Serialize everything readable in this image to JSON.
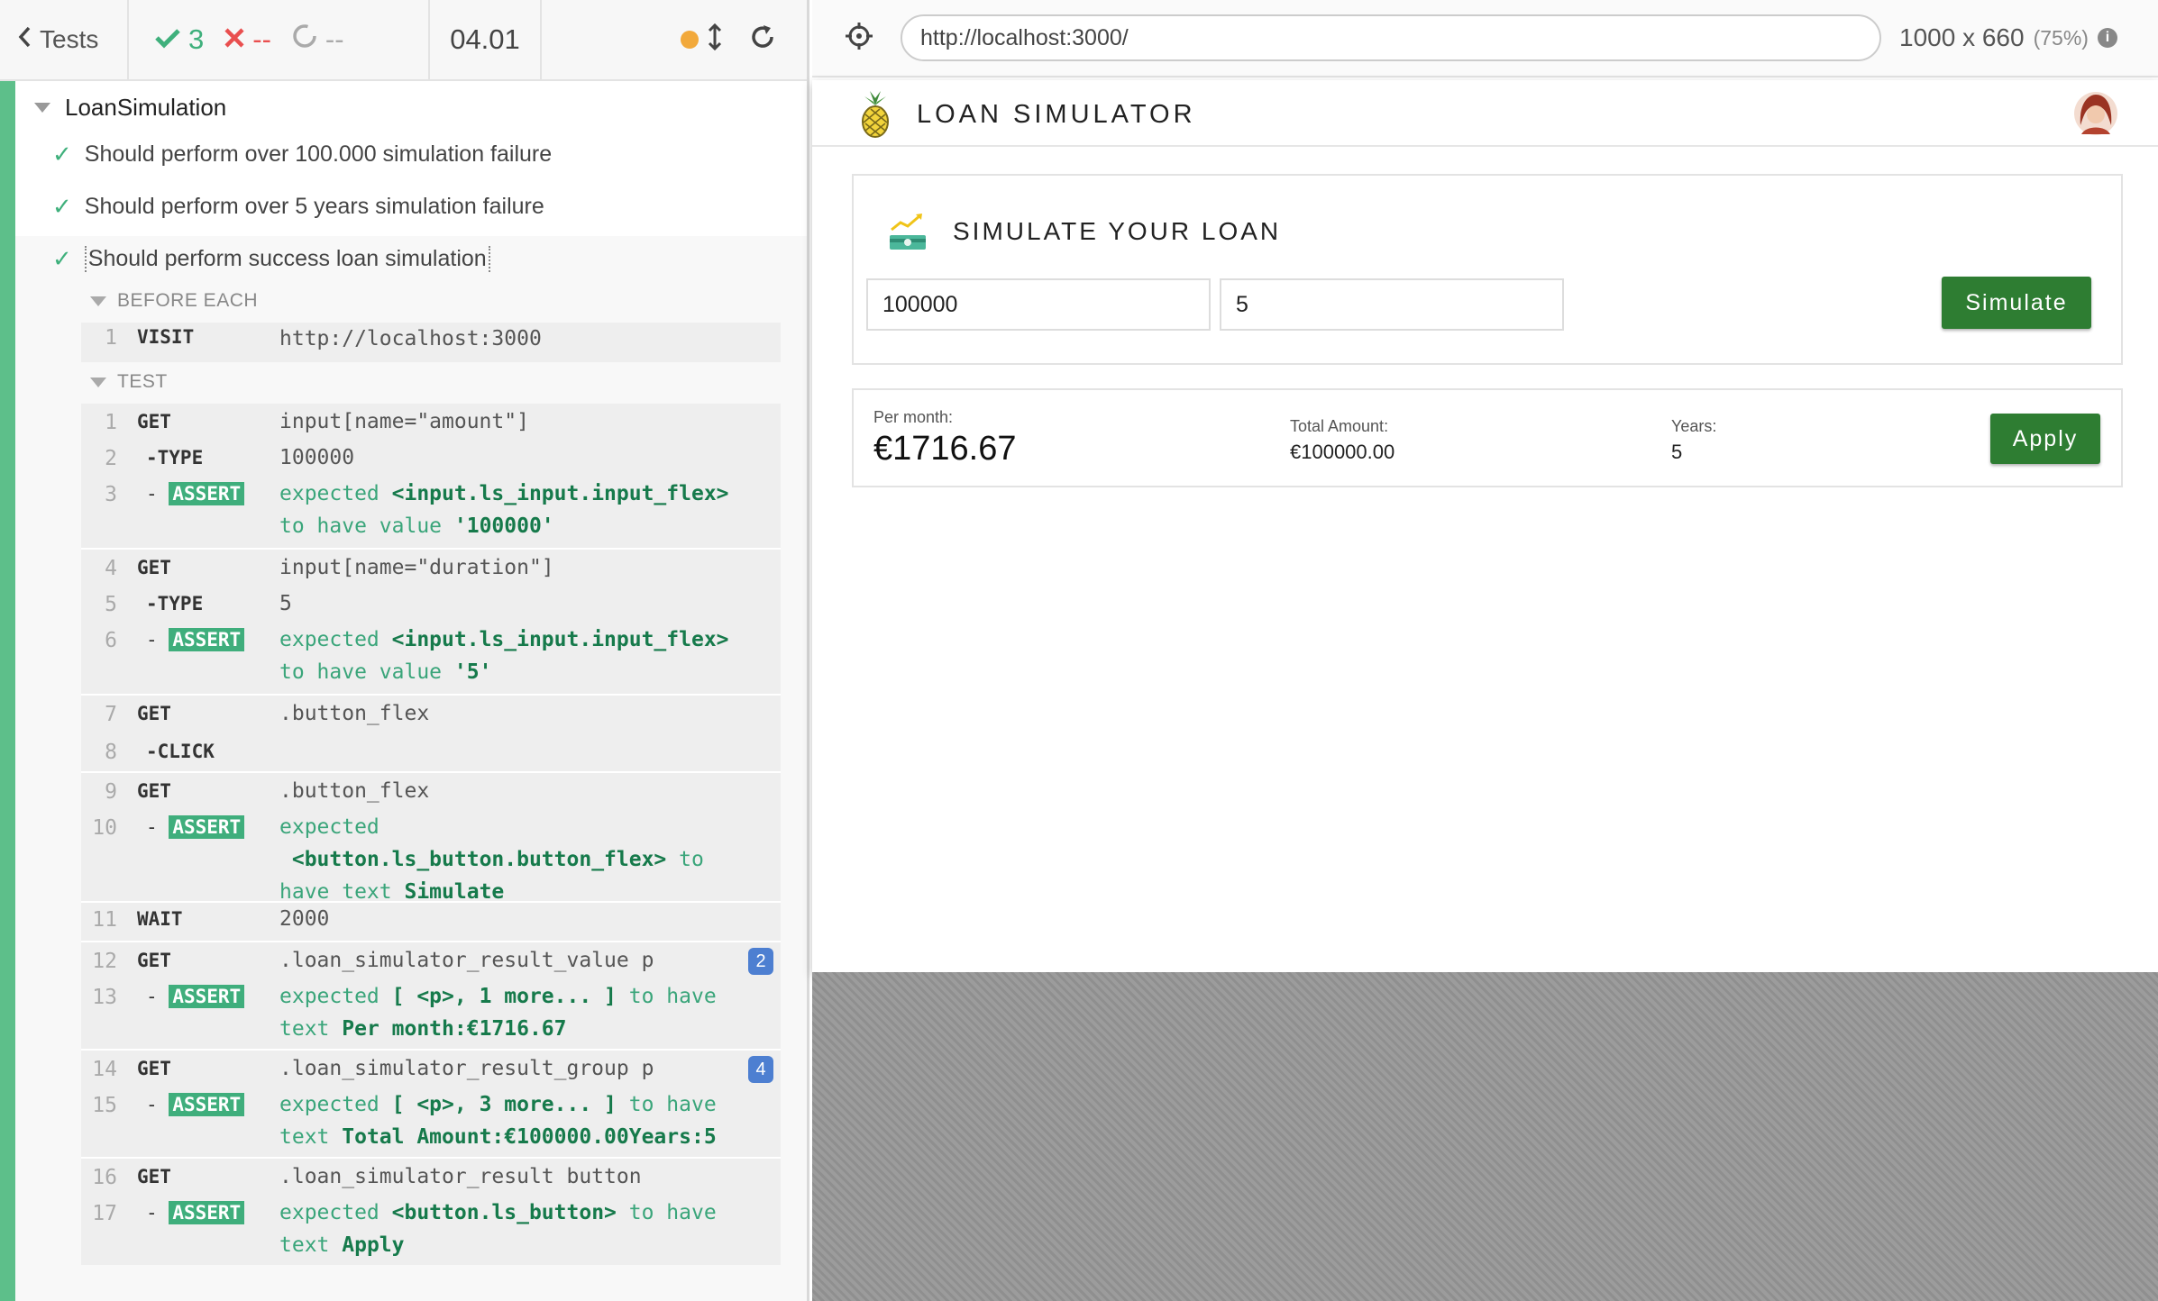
{
  "reporter": {
    "header": {
      "back_label": "Tests",
      "passed": "3",
      "failed": "--",
      "pending": "--",
      "duration": "04.01"
    },
    "suite": "LoanSimulation",
    "tests": [
      "Should perform over 100.000 simulation failure",
      "Should perform over 5 years simulation failure",
      "Should perform success loan simulation"
    ],
    "hooks": {
      "before_each": "BEFORE EACH",
      "test": "TEST"
    },
    "commands": [
      {
        "num": "1",
        "name": "VISIT",
        "msg": "http://localhost:3000"
      },
      {
        "num": "1",
        "name": "GET",
        "msg": "input[name=\"amount\"]"
      },
      {
        "num": "2",
        "name": "-TYPE",
        "msg": "100000"
      },
      {
        "num": "3",
        "name": "ASSERT",
        "pre": "expected",
        "sub": "<input.ls_input.input_flex>",
        "mid": "to have value",
        "val": "'100000'"
      },
      {
        "num": "4",
        "name": "GET",
        "msg": "input[name=\"duration\"]"
      },
      {
        "num": "5",
        "name": "-TYPE",
        "msg": "5"
      },
      {
        "num": "6",
        "name": "ASSERT",
        "pre": "expected",
        "sub": "<input.ls_input.input_flex>",
        "mid": "to have value",
        "val": "'5'"
      },
      {
        "num": "7",
        "name": "GET",
        "msg": ".button_flex"
      },
      {
        "num": "8",
        "name": "-CLICK",
        "msg": ""
      },
      {
        "num": "9",
        "name": "GET",
        "msg": ".button_flex"
      },
      {
        "num": "10",
        "name": "ASSERT",
        "pre": "expected",
        "sub": "<button.ls_button.button_flex>",
        "mid": "to have text",
        "val": "Simulate"
      },
      {
        "num": "11",
        "name": "WAIT",
        "msg": "2000"
      },
      {
        "num": "12",
        "name": "GET",
        "msg": ".loan_simulator_result_value p",
        "badge": "2"
      },
      {
        "num": "13",
        "name": "ASSERT",
        "pre": "expected",
        "sub": "[ <p>, 1 more... ]",
        "mid": "to have text",
        "val": "Per month:€1716.67"
      },
      {
        "num": "14",
        "name": "GET",
        "msg": ".loan_simulator_result_group p",
        "badge": "4"
      },
      {
        "num": "15",
        "name": "ASSERT",
        "pre": "expected",
        "sub": "[ <p>, 3 more... ]",
        "mid": "to have text",
        "val": "Total Amount:€100000.00Years:5"
      },
      {
        "num": "16",
        "name": "GET",
        "msg": ".loan_simulator_result button"
      },
      {
        "num": "17",
        "name": "ASSERT",
        "pre": "expected",
        "sub": "<button.ls_button>",
        "mid": "to have text",
        "val": "Apply"
      }
    ],
    "assert_tag": "ASSERT",
    "assert_prefix": "-",
    "to_word": "to",
    "have_text": "have text",
    "to_have": "to have",
    "text_word": "text"
  },
  "browser": {
    "url": "http://localhost:3000/",
    "viewport": "1000 x 660",
    "scale": "(75%)"
  },
  "app": {
    "title": "LOAN SIMULATOR",
    "simulate_title": "SIMULATE YOUR LOAN",
    "amount_value": "100000",
    "duration_value": "5",
    "simulate_button": "Simulate",
    "result": {
      "per_month_label": "Per month:",
      "per_month_value": "€1716.67",
      "total_label": "Total Amount:",
      "total_value": "€100000.00",
      "years_label": "Years:",
      "years_value": "5",
      "apply_button": "Apply"
    }
  },
  "colors": {
    "pass": "#3fb07c",
    "fail": "#e94f4f",
    "brand_green": "#2e7d32",
    "badge_blue": "#4d7fd1"
  }
}
